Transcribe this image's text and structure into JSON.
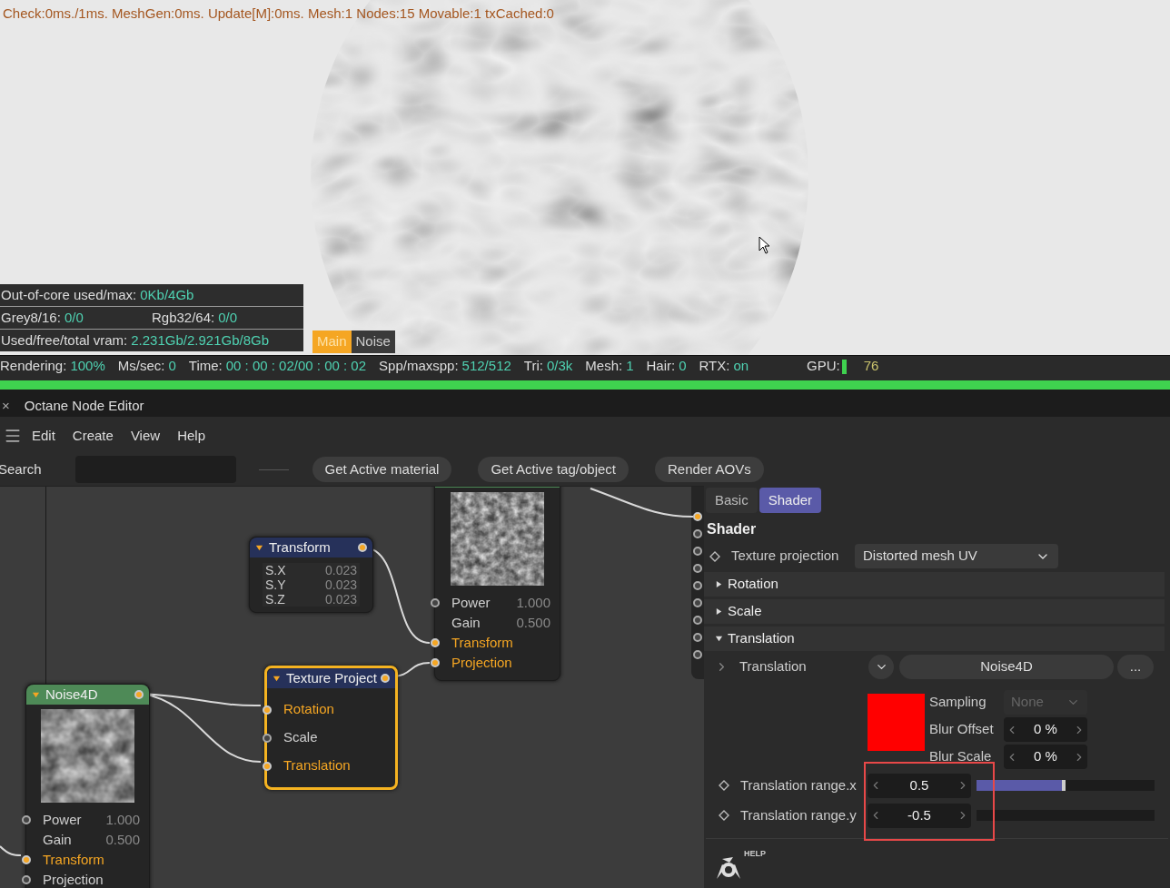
{
  "viewport": {
    "info_line": "Check:0ms./1ms. MeshGen:0ms. Update[M]:0ms. Mesh:1 Nodes:15 Movable:1 txCached:0",
    "stats": [
      {
        "items": [
          {
            "label": "Out-of-core used/max:",
            "value": "0Kb/4Gb"
          }
        ]
      },
      {
        "items": [
          {
            "label": "Grey8/16:",
            "value": "0/0"
          },
          {
            "label": "Rgb32/64:",
            "value": "0/0"
          }
        ]
      },
      {
        "items": [
          {
            "label": "Used/free/total vram:",
            "value": "2.231Gb/2.921Gb/8Gb"
          }
        ]
      }
    ],
    "tabs": [
      {
        "label": "Main",
        "selected": true
      },
      {
        "label": "Noise",
        "selected": false
      }
    ]
  },
  "status_bar": [
    {
      "label": "Rendering:",
      "value": "100%"
    },
    {
      "label": "Ms/sec:",
      "value": "0"
    },
    {
      "label": "Time:",
      "value": "00 : 00 : 02/00 : 00 : 02"
    },
    {
      "label": "Spp/maxspp:",
      "value": "512/512"
    },
    {
      "label": "Tri:",
      "value": "0/3k"
    },
    {
      "label": "Mesh:",
      "value": "1"
    },
    {
      "label": "Hair:",
      "value": "0"
    },
    {
      "label": "RTX:",
      "value": "on"
    }
  ],
  "gpu": {
    "label": "GPU:",
    "value": "76"
  },
  "progress": {
    "level": 1
  },
  "node_editor": {
    "close": "×",
    "title": "Octane Node Editor",
    "menu": [
      "Edit",
      "Create",
      "View",
      "Help"
    ],
    "search": {
      "label": "Search"
    },
    "buttons": [
      "Get Active material",
      "Get Active tag/object",
      "Render AOVs"
    ],
    "nodes": [
      {
        "kind": "texture",
        "color": "#4e8a57",
        "selected": false,
        "inputs": [
          {
            "name": "Power",
            "value": "1.000",
            "socket": true,
            "linked": false
          },
          {
            "name": "Gain",
            "value": "0.500",
            "socket": false,
            "linked": false
          },
          {
            "name": "Transform",
            "socket": true,
            "linked": true
          },
          {
            "name": "Projection",
            "socket": true,
            "linked": true
          }
        ]
      },
      {
        "kind": "params",
        "title": "Transform",
        "color": "#26315a",
        "selected": false,
        "params": [
          {
            "name": "S.X",
            "value": "0.023"
          },
          {
            "name": "S.Y",
            "value": "0.023"
          },
          {
            "name": "S.Z",
            "value": "0.023"
          }
        ]
      },
      {
        "kind": "sockets",
        "title": "Texture Project",
        "color": "#26315a",
        "selected": true,
        "inputs": [
          {
            "name": "Rotation",
            "socket": true,
            "linked": true
          },
          {
            "name": "Scale",
            "socket": true,
            "linked": false
          },
          {
            "name": "Translation",
            "socket": true,
            "linked": true
          }
        ]
      },
      {
        "kind": "texture",
        "title": "Noise4D",
        "color": "#4e8a57",
        "selected": false,
        "inputs": [
          {
            "name": "Power",
            "value": "1.000",
            "socket": true,
            "linked": false
          },
          {
            "name": "Gain",
            "value": "0.500",
            "socket": false,
            "linked": false
          },
          {
            "name": "Transform",
            "socket": true,
            "linked": true
          },
          {
            "name": "Projection",
            "socket": true,
            "linked": false
          }
        ]
      }
    ],
    "edge_sockets": [
      {
        "linked": true
      },
      {
        "linked": false
      },
      {
        "linked": false
      },
      {
        "linked": false
      },
      {
        "linked": false
      },
      {
        "linked": false
      },
      {
        "linked": false
      },
      {
        "linked": false
      },
      {
        "linked": false
      }
    ],
    "inspector": {
      "tabs": [
        {
          "label": "Basic",
          "selected": false
        },
        {
          "label": "Shader",
          "selected": true
        }
      ],
      "heading": "Shader",
      "rows": [
        {
          "kind": "dropdown",
          "label": "Texture projection",
          "value": "Distorted mesh UV"
        },
        {
          "kind": "group",
          "label": "Rotation",
          "expanded": false
        },
        {
          "kind": "group",
          "label": "Scale",
          "expanded": false
        },
        {
          "kind": "group",
          "label": "Translation",
          "expanded": true
        },
        {
          "kind": "link",
          "label": "Translation",
          "value": "Noise4D",
          "more": "..."
        },
        {
          "kind": "swatch",
          "color": "#ff0000",
          "params": [
            {
              "label": "Sampling",
              "value": "None",
              "disabled": true
            },
            {
              "label": "Blur Offset",
              "value": "0 %",
              "disabled": false
            },
            {
              "label": "Blur Scale",
              "value": "0 %",
              "disabled": false
            }
          ]
        },
        {
          "kind": "slider",
          "label": "Translation range.x",
          "value": "0.5",
          "level": 0.5
        },
        {
          "kind": "slider",
          "label": "Translation range.y",
          "value": "-0.5",
          "level": 0
        }
      ],
      "help": "HELP"
    }
  }
}
